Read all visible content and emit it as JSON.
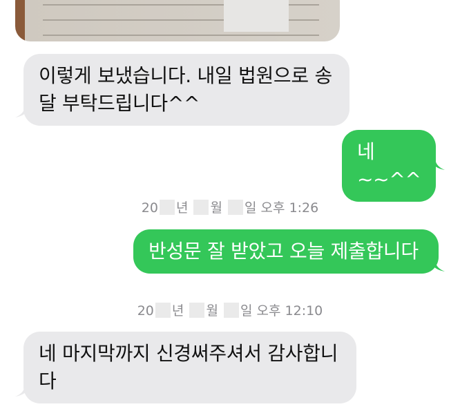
{
  "messages": [
    {
      "direction": "incoming",
      "text": "이렇게 보냈습니다. 내일 법원으로 송달 부탁드립니다^^"
    },
    {
      "direction": "outgoing",
      "text": "네~~^^"
    },
    {
      "direction": "outgoing",
      "text": "반성문 잘 받았고 오늘 제출합니다"
    },
    {
      "direction": "incoming",
      "text": "네 마지막까지 신경써주셔서 감사합니다"
    }
  ],
  "timestamps": [
    {
      "year_prefix": "20",
      "year_unit": "년",
      "month_unit": "월",
      "day_unit": "일",
      "period": "오후",
      "time": "1:26"
    },
    {
      "year_prefix": "20",
      "year_unit": "년",
      "month_unit": "월",
      "day_unit": "일",
      "period": "오후",
      "time": "12:10"
    }
  ],
  "colors": {
    "incoming_bubble": "#e9e9eb",
    "outgoing_bubble": "#34c759",
    "timestamp_text": "#8a8a8e"
  }
}
